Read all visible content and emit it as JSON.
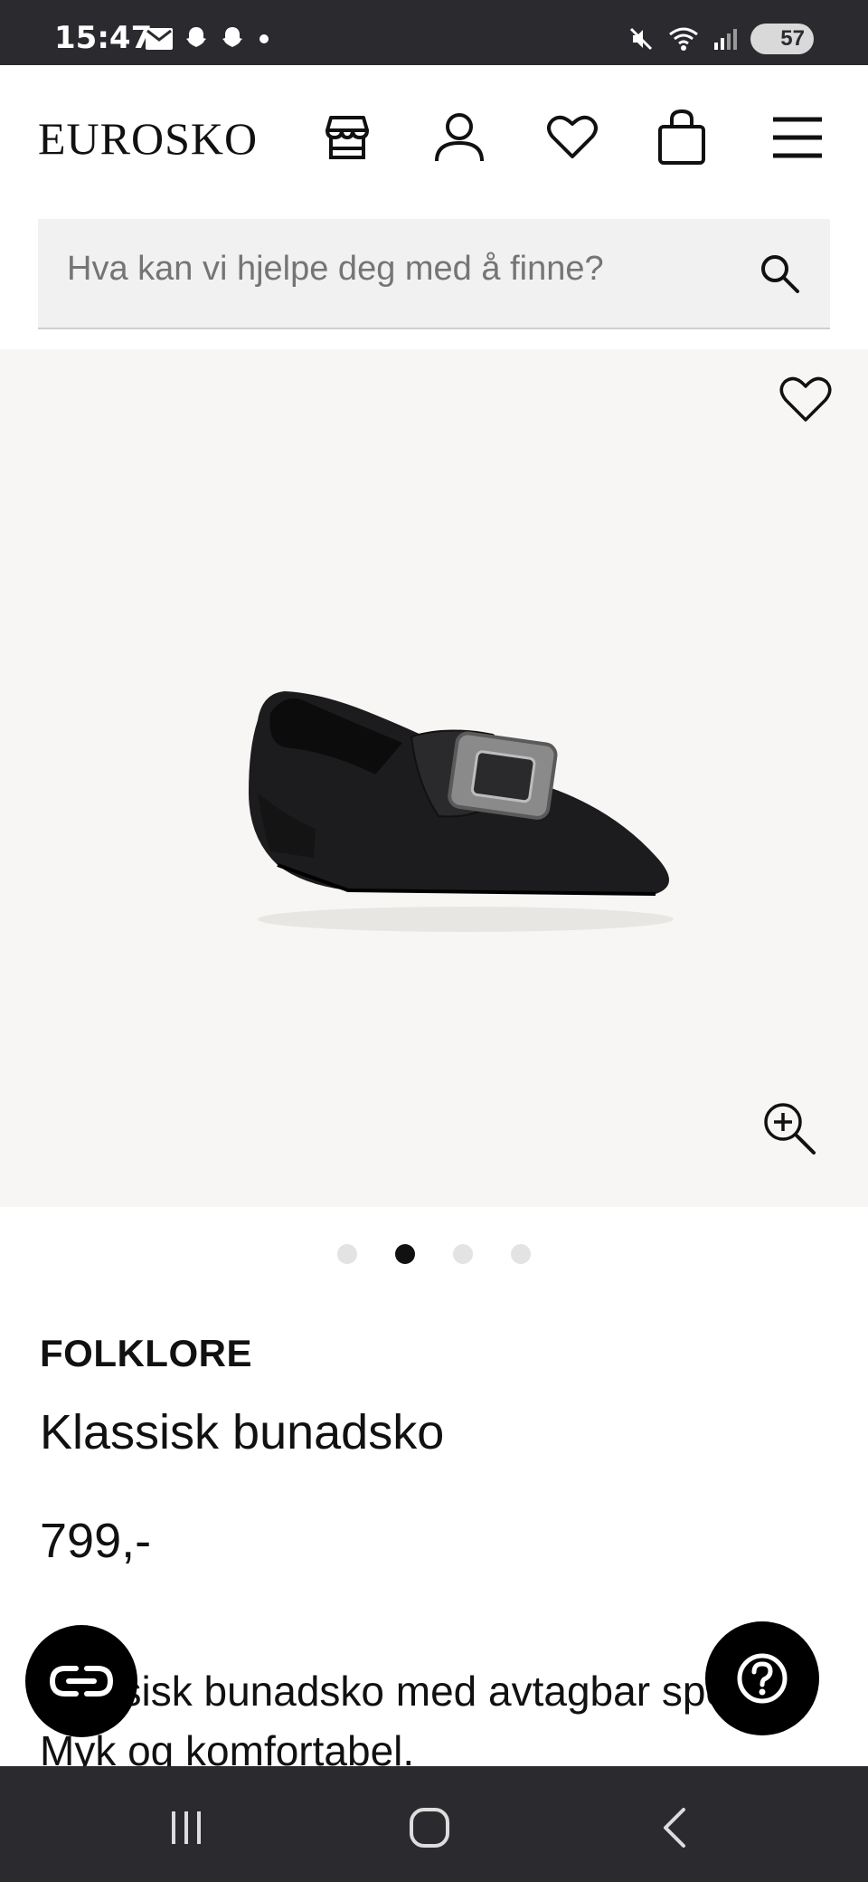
{
  "status_bar": {
    "time": "15:47",
    "battery": "57",
    "icons": [
      "mail-icon",
      "snapchat-icon",
      "snapchat-icon",
      "dot-icon",
      "mute-icon",
      "wifi-icon",
      "signal-icon",
      "battery-icon"
    ]
  },
  "header": {
    "logo": "EUROSKO",
    "icons": [
      "store-icon",
      "account-icon",
      "wishlist-heart-icon",
      "shopping-bag-icon",
      "menu-icon"
    ]
  },
  "search": {
    "placeholder": "Hva kan vi hjelpe deg med å finne?"
  },
  "gallery": {
    "total_images": 4,
    "active_index": 1
  },
  "product": {
    "brand": "FOLKLORE",
    "title": "Klassisk bunadsko",
    "price": "799,-",
    "description": "Klassisk bunadsko med avtagbar spenne. Myk og komfortabel."
  },
  "fabs": {
    "left_icon": "link-chat-icon",
    "right_icon": "help-icon"
  },
  "nav": [
    "recents-icon",
    "home-icon",
    "back-icon"
  ]
}
